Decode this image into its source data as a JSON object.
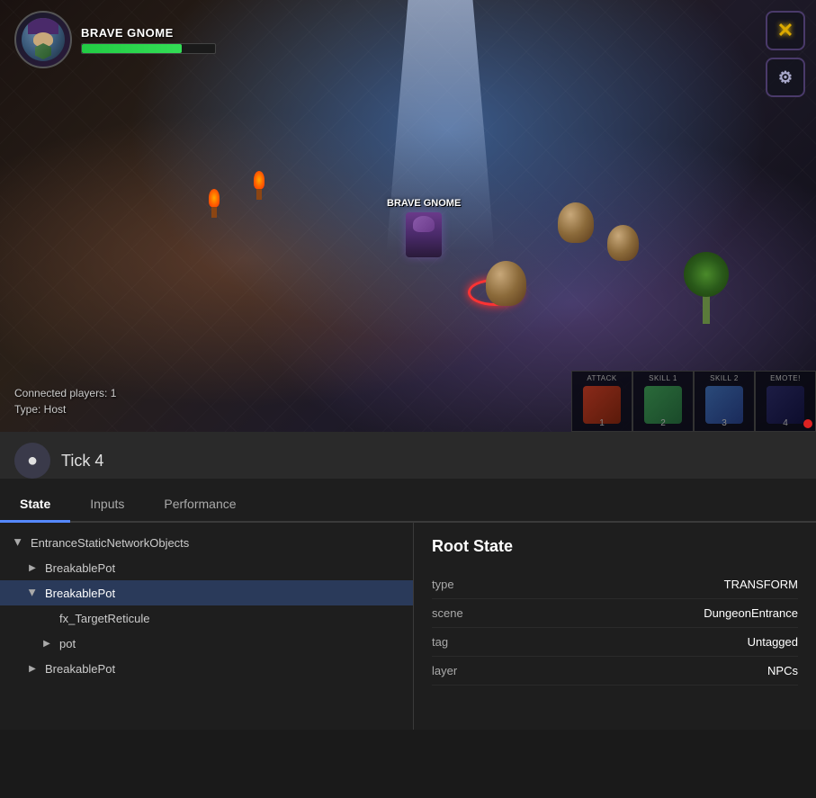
{
  "game": {
    "player_name": "BRAVE GNOME",
    "player_name_tag": "BRAVE GNOME",
    "health_percent": 75,
    "connected_players": "Connected players: 1",
    "type_label": "Type: Host",
    "light_shaft": true
  },
  "hud": {
    "x_button_label": "✕",
    "settings_icon": "⚙",
    "skills": [
      {
        "id": "attack",
        "label": "ATTACK",
        "num": "1"
      },
      {
        "id": "skill1",
        "label": "SKILL 1",
        "num": "2"
      },
      {
        "id": "skill2",
        "label": "SKILL 2",
        "num": "3"
      },
      {
        "id": "skill4",
        "label": "EMOTE!",
        "num": "4"
      }
    ]
  },
  "debug": {
    "tick_label": "Tick 4",
    "tabs": [
      {
        "id": "state",
        "label": "State"
      },
      {
        "id": "inputs",
        "label": "Inputs"
      },
      {
        "id": "performance",
        "label": "Performance"
      }
    ],
    "active_tab": "state",
    "tree": {
      "root": "EntranceStaticNetworkObjects",
      "items": [
        {
          "id": "root",
          "label": "EntranceStaticNetworkObjects",
          "level": 0,
          "expanded": true,
          "arrow": "expanded"
        },
        {
          "id": "breakable1",
          "label": "BreakablePot",
          "level": 1,
          "expanded": false,
          "arrow": "collapsed"
        },
        {
          "id": "breakable2",
          "label": "BreakablePot",
          "level": 1,
          "expanded": true,
          "arrow": "expanded",
          "selected": true
        },
        {
          "id": "fx_target",
          "label": "fx_TargetReticule",
          "level": 2,
          "arrow": "none"
        },
        {
          "id": "pot",
          "label": "pot",
          "level": 2,
          "expanded": false,
          "arrow": "collapsed"
        },
        {
          "id": "breakable3",
          "label": "BreakablePot",
          "level": 1,
          "expanded": false,
          "arrow": "collapsed"
        }
      ]
    },
    "props": {
      "title": "Root State",
      "rows": [
        {
          "key": "type",
          "value": "TRANSFORM"
        },
        {
          "key": "scene",
          "value": "DungeonEntrance"
        },
        {
          "key": "tag",
          "value": "Untagged"
        },
        {
          "key": "layer",
          "value": "NPCs"
        }
      ]
    }
  }
}
